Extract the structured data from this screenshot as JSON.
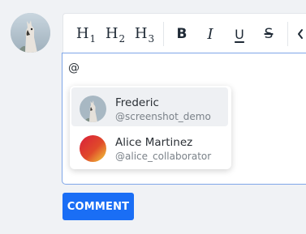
{
  "toolbar": {
    "h1": {
      "letter": "H",
      "level": "1"
    },
    "h2": {
      "letter": "H",
      "level": "2"
    },
    "h3": {
      "letter": "H",
      "level": "3"
    },
    "bold": "B",
    "italic": "I",
    "underline": "U",
    "strikethrough": "S"
  },
  "editor": {
    "text": "@"
  },
  "mentions": [
    {
      "name": "Frederic",
      "handle": "@screenshot_demo",
      "selected": true
    },
    {
      "name": "Alice Martinez",
      "handle": "@alice_collaborator",
      "selected": false
    }
  ],
  "comment_button": "COMMENT",
  "colors": {
    "accent": "#1a6ef5",
    "editor_focus_border": "#7fa6e8",
    "page_background": "#f0f2f5"
  }
}
